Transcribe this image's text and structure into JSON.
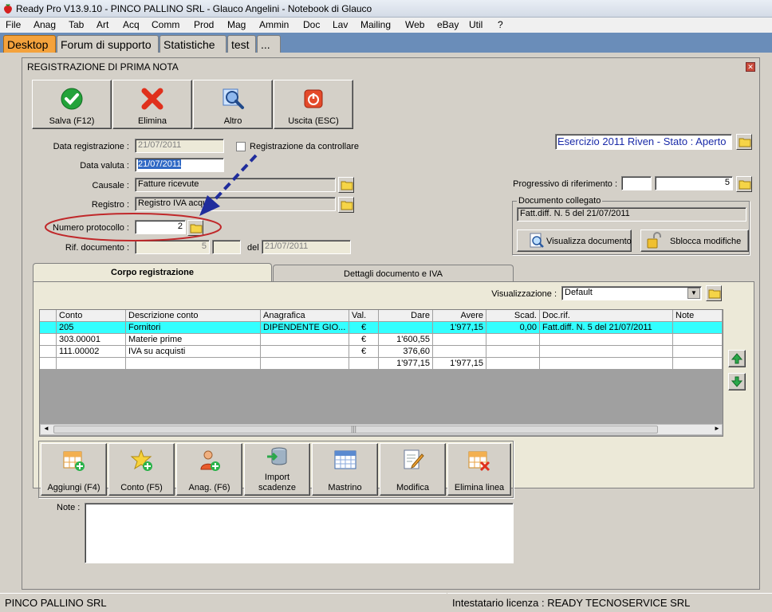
{
  "window": {
    "title": "Ready Pro V13.9.10 - PINCO PALLINO SRL - Glauco Angelini - Notebook di Glauco"
  },
  "menu": [
    "File",
    "Anag",
    "Tab",
    "Art",
    "Acq",
    "Comm",
    "Prod",
    "Mag",
    "Ammin",
    "Doc",
    "Lav",
    "Mailing",
    "Web",
    "eBay",
    "Util",
    "?"
  ],
  "top_tabs": [
    "Desktop",
    "Forum di supporto",
    "Statistiche",
    "test",
    "..."
  ],
  "dialog": {
    "title": "REGISTRAZIONE DI PRIMA NOTA",
    "toolbar": {
      "save": "Salva (F12)",
      "delete": "Elimina",
      "other": "Altro",
      "exit": "Uscita (ESC)"
    },
    "form": {
      "data_registrazione_label": "Data registrazione :",
      "data_registrazione": "21/07/2011",
      "data_valuta_label": "Data valuta :",
      "data_valuta": "21/07/2011",
      "da_controllare_label": "Registrazione da controllare",
      "causale_label": "Causale :",
      "causale": "Fatture ricevute",
      "registro_label": "Registro :",
      "registro": "Registro IVA acqu",
      "numero_protocollo_label": "Numero protocollo :",
      "numero_protocollo": "2",
      "rif_documento_label": "Rif. documento :",
      "rif_documento_num": "5",
      "del_label": "del",
      "rif_documento_date": "21/07/2011",
      "esercizio": "Esercizio 2011 Riven - Stato : Aperto",
      "progressivo_label": "Progressivo di riferimento :",
      "progressivo_value": "5",
      "documento_collegato_label": "Documento collegato",
      "documento_collegato": "Fatt.diff. N. 5 del 21/07/2011",
      "visualizza_documento": "Visualizza documento",
      "sblocca_modifiche": "Sblocca modifiche"
    },
    "tabs": [
      "Corpo registrazione",
      "Dettagli documento e IVA"
    ],
    "visualizzazione_label": "Visualizzazione :",
    "visualizzazione_value": "Default",
    "grid": {
      "columns": [
        "Conto",
        "Descrizione conto",
        "Anagrafica",
        "Val.",
        "Dare",
        "Avere",
        "Scad.",
        "Doc.rif.",
        "Note"
      ],
      "rows": [
        [
          "205",
          "Fornitori",
          "DIPENDENTE GIO...",
          "€",
          "",
          "1'977,15",
          "0,00",
          "Fatt.diff. N. 5 del 21/07/2011",
          ""
        ],
        [
          "303.00001",
          "Materie prime",
          "",
          "€",
          "1'600,55",
          "",
          "",
          "",
          ""
        ],
        [
          "111.00002",
          "IVA su acquisti",
          "",
          "€",
          "376,60",
          "",
          "",
          "",
          ""
        ],
        [
          "",
          "",
          "",
          "",
          "1'977,15",
          "1'977,15",
          "",
          "",
          ""
        ]
      ]
    },
    "actions": {
      "aggiungi": "Aggiungi (F4)",
      "conto": "Conto (F5)",
      "anag": "Anag. (F6)",
      "import_l1": "Import",
      "import_l2": "scadenze",
      "mastrino": "Mastrino",
      "modifica": "Modifica",
      "elimina_linea": "Elimina linea"
    },
    "note_label": "Note :"
  },
  "status": {
    "company": "PINCO PALLINO SRL",
    "license": "Intestatario licenza : READY TECNOSERVICE SRL"
  }
}
